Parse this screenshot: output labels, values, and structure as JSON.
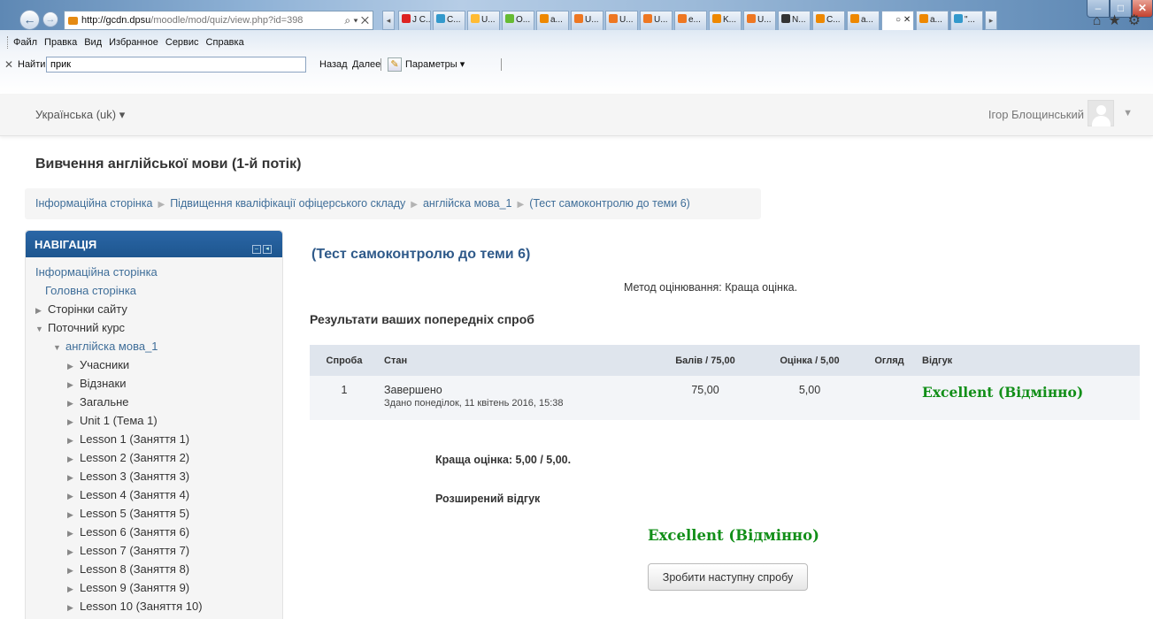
{
  "browser": {
    "address_host": "http://gcdn.dpsu",
    "address_path": "/moodle/mod/quiz/view.php?id=398",
    "address_tools": "⌕ ▾ ✕",
    "tabs": [
      {
        "label": "J C...",
        "icon_color": "#d22"
      },
      {
        "label": "C...",
        "icon_color": "#39c"
      },
      {
        "label": "U...",
        "icon_color": "#fb3"
      },
      {
        "label": "O...",
        "icon_color": "#6b3"
      },
      {
        "label": "a...",
        "icon_color": "#e80"
      },
      {
        "label": "U...",
        "icon_color": "#e72"
      },
      {
        "label": "U...",
        "icon_color": "#e72"
      },
      {
        "label": "U...",
        "icon_color": "#e72"
      },
      {
        "label": "e...",
        "icon_color": "#e72"
      },
      {
        "label": "K...",
        "icon_color": "#e80"
      },
      {
        "label": "U...",
        "icon_color": "#e72"
      },
      {
        "label": "N...",
        "icon_color": "#333"
      },
      {
        "label": "C...",
        "icon_color": "#e80"
      },
      {
        "label": "a...",
        "icon_color": "#e80"
      },
      {
        "label": "○ ✕",
        "icon_color": "#fff",
        "active": true
      },
      {
        "label": "a...",
        "icon_color": "#e80"
      },
      {
        "label": "\"...",
        "icon_color": "#39c"
      }
    ],
    "menu": [
      "Файл",
      "Правка",
      "Вид",
      "Избранное",
      "Сервис",
      "Справка"
    ],
    "find_label": "Найти:",
    "find_value": "прик",
    "find_prev": "Назад",
    "find_next": "Далее",
    "find_options": "Параметры ▾"
  },
  "header": {
    "language": "Українська (uk) ▾",
    "user_name": "Ігор Блощинський"
  },
  "course_title": "Вивчення англійської мови (1-й потік)",
  "breadcrumb": [
    "Інформаційна сторінка",
    "Підвищення кваліфікації офіцерського складу",
    "англійска мова_1",
    "(Тест самоконтролю до теми 6)"
  ],
  "navigation": {
    "title": "НАВІГАЦІЯ",
    "items": [
      {
        "label": "Інформаційна сторінка"
      },
      {
        "label": "Головна сторінка"
      },
      {
        "label": "Сторінки сайту"
      },
      {
        "label": "Поточний курс"
      },
      {
        "label": "англійска мова_1"
      },
      {
        "label": "Учасники"
      },
      {
        "label": "Відзнаки"
      },
      {
        "label": "Загальне"
      },
      {
        "label": "Unit 1 (Тема 1)"
      },
      {
        "label": "Lesson 1 (Заняття 1)"
      },
      {
        "label": "Lesson 2 (Заняття 2)"
      },
      {
        "label": "Lesson 3 (Заняття 3)"
      },
      {
        "label": "Lesson 4 (Заняття 4)"
      },
      {
        "label": "Lesson 5 (Заняття 5)"
      },
      {
        "label": "Lesson 6 (Заняття 6)"
      },
      {
        "label": "Lesson 7 (Заняття 7)"
      },
      {
        "label": "Lesson 8 (Заняття 8)"
      },
      {
        "label": "Lesson 9 (Заняття 9)"
      },
      {
        "label": "Lesson 10 (Заняття 10)"
      }
    ]
  },
  "quiz": {
    "title": "(Тест самоконтролю до теми 6)",
    "grading_method": "Метод оцінювання: Краща оцінка.",
    "prev_attempts_title": "Результати ваших попередніх спроб",
    "table": {
      "headers": [
        "Спроба",
        "Стан",
        "Балів / 75,00",
        "Оцінка / 5,00",
        "Огляд",
        "Відгук"
      ],
      "rows": [
        {
          "attempt": "1",
          "state": "Завершено",
          "submitted": "Здано понеділок, 11 квітень 2016, 15:38",
          "marks": "75,00",
          "grade": "5,00",
          "review": "",
          "feedback": "Excellent (Відмінно)"
        }
      ]
    },
    "best_grade": "Краща оцінка: 5,00 / 5,00.",
    "overall_feedback_title": "Розширений відгук",
    "overall_feedback": "Excellent (Відмінно)",
    "next_attempt_button": "Зробити наступну спробу"
  },
  "colors": {
    "nav_header": "#2a66a6",
    "link": "#3f6e99",
    "feedback_green": "#128f19"
  }
}
